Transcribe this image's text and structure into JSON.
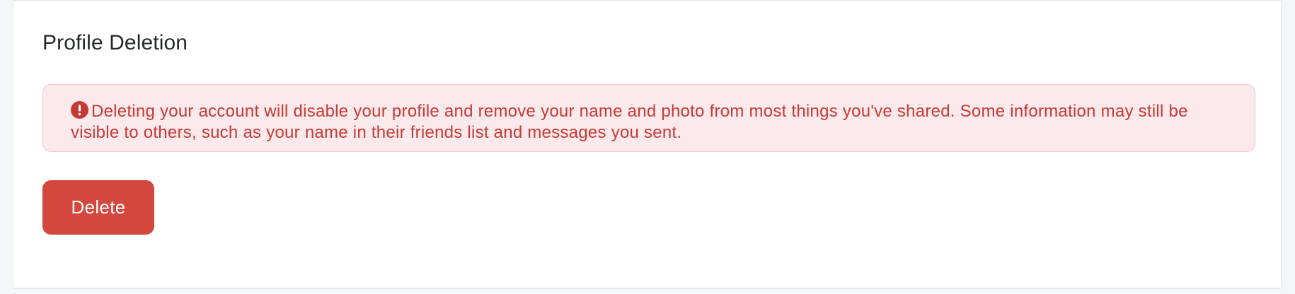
{
  "profile_deletion": {
    "title": "Profile Deletion",
    "warning": {
      "icon": "exclamation-circle-icon",
      "message": "Deleting your account will disable your profile and remove your name and photo from most things you've shared. Some information may still be visible to others, such as your name in their friends list and messages you sent."
    },
    "delete_label": "Delete"
  },
  "colors": {
    "danger": "#d3473d",
    "alert_text": "#c63a35",
    "alert_background": "#fbe9eb",
    "alert_border": "#f4c6cc"
  }
}
